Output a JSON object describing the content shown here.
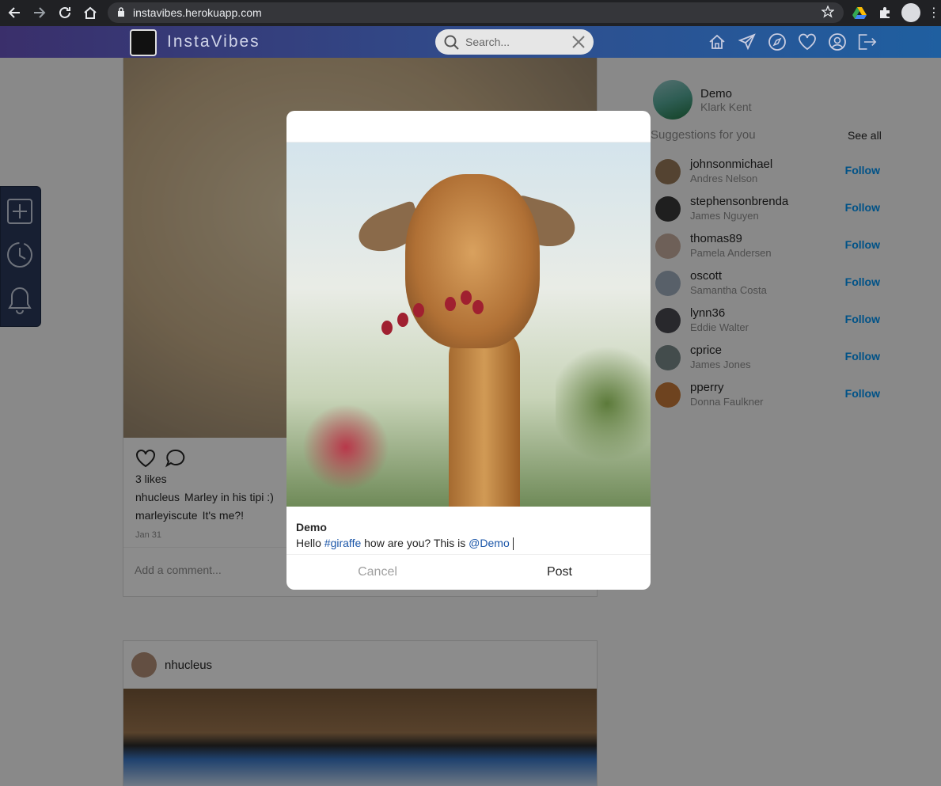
{
  "browser": {
    "url": "instavibes.herokuapp.com"
  },
  "app": {
    "brand": "InstaVibes",
    "search_placeholder": "Search..."
  },
  "feed": {
    "post1": {
      "likes": "3 likes",
      "comments": [
        {
          "user": "nhucleus",
          "text": "Marley in his tipi :)"
        },
        {
          "user": "marleyiscute",
          "text": "It's me?!"
        }
      ],
      "date": "Jan 31",
      "add_comment_placeholder": "Add a comment..."
    },
    "post2": {
      "user": "nhucleus"
    }
  },
  "profile": {
    "username": "Demo",
    "full_name": "Klark Kent"
  },
  "suggestions": {
    "title": "Suggestions for you",
    "see_all": "See all",
    "follow_label": "Follow",
    "items": [
      {
        "username": "johnsonmichael",
        "name": "Andres Nelson",
        "color": "#9a7a5a"
      },
      {
        "username": "stephensonbrenda",
        "name": "James Nguyen",
        "color": "#3a3a3a"
      },
      {
        "username": "thomas89",
        "name": "Pamela Andersen",
        "color": "#c8b0a0"
      },
      {
        "username": "oscott",
        "name": "Samantha Costa",
        "color": "#a0b0c0"
      },
      {
        "username": "lynn36",
        "name": "Eddie Walter",
        "color": "#4a4a50"
      },
      {
        "username": "cprice",
        "name": "James Jones",
        "color": "#7a8a8a"
      },
      {
        "username": "pperry",
        "name": "Donna Faulkner",
        "color": "#c87a3a"
      }
    ]
  },
  "modal": {
    "author": "Demo",
    "caption_parts": [
      "Hello ",
      "#giraffe",
      " how are you? This is ",
      "@Demo"
    ],
    "cancel": "Cancel",
    "post": "Post"
  }
}
